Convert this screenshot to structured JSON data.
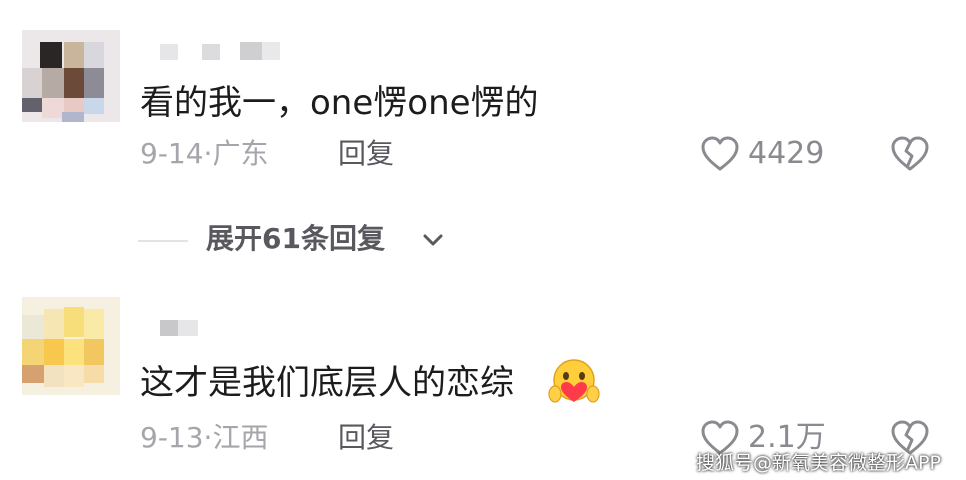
{
  "comments": [
    {
      "text": "看的我一，one愣one愣的",
      "date": "9-14",
      "location": "广东",
      "reply_label": "回复",
      "like_icon": "heart-outline-icon",
      "likes": "4429",
      "dislike_icon": "broken-heart-icon"
    },
    {
      "text": "这才是我们底层人的恋综",
      "emoji": "hugging-face-emoji",
      "date": "9-13",
      "location": "江西",
      "reply_label": "回复",
      "like_icon": "heart-outline-icon",
      "likes": "2.1万",
      "dislike_icon": "broken-heart-icon"
    }
  ],
  "expand_replies": {
    "label": "展开61条回复",
    "icon": "chevron-down-icon"
  },
  "separator": "·",
  "watermark": "搜狐号@新氧美容微整形APP"
}
